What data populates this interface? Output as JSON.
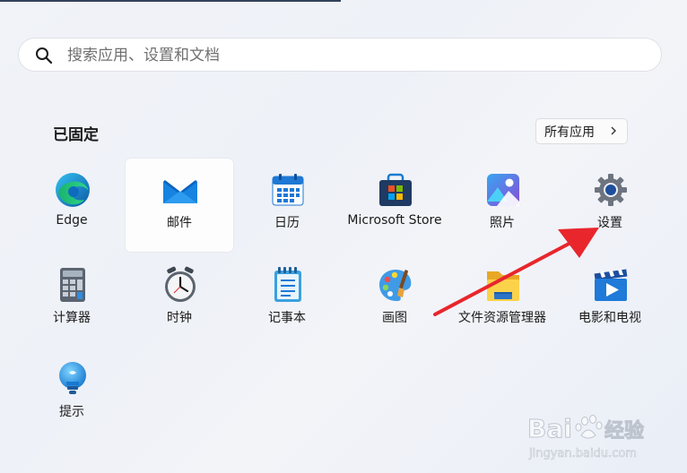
{
  "search": {
    "placeholder": "搜索应用、设置和文档"
  },
  "pinned": {
    "title": "已固定",
    "all_apps_label": "所有应用"
  },
  "apps": [
    {
      "label": "Edge",
      "icon": "edge-icon"
    },
    {
      "label": "邮件",
      "icon": "mail-icon"
    },
    {
      "label": "日历",
      "icon": "calendar-icon"
    },
    {
      "label": "Microsoft Store",
      "icon": "store-icon"
    },
    {
      "label": "照片",
      "icon": "photos-icon"
    },
    {
      "label": "设置",
      "icon": "settings-icon"
    },
    {
      "label": "计算器",
      "icon": "calculator-icon"
    },
    {
      "label": "时钟",
      "icon": "clock-icon"
    },
    {
      "label": "记事本",
      "icon": "notepad-icon"
    },
    {
      "label": "画图",
      "icon": "paint-icon"
    },
    {
      "label": "文件资源管理器",
      "icon": "file-explorer-icon"
    },
    {
      "label": "电影和电视",
      "icon": "movies-tv-icon"
    },
    {
      "label": "提示",
      "icon": "tips-icon"
    }
  ],
  "watermark": {
    "brand": "Bai",
    "brand_suffix": "du",
    "product": "经验",
    "url": "jingyan.baidu.com"
  },
  "colors": {
    "accent": "#0067c0",
    "annotation_arrow": "#e8262c"
  }
}
